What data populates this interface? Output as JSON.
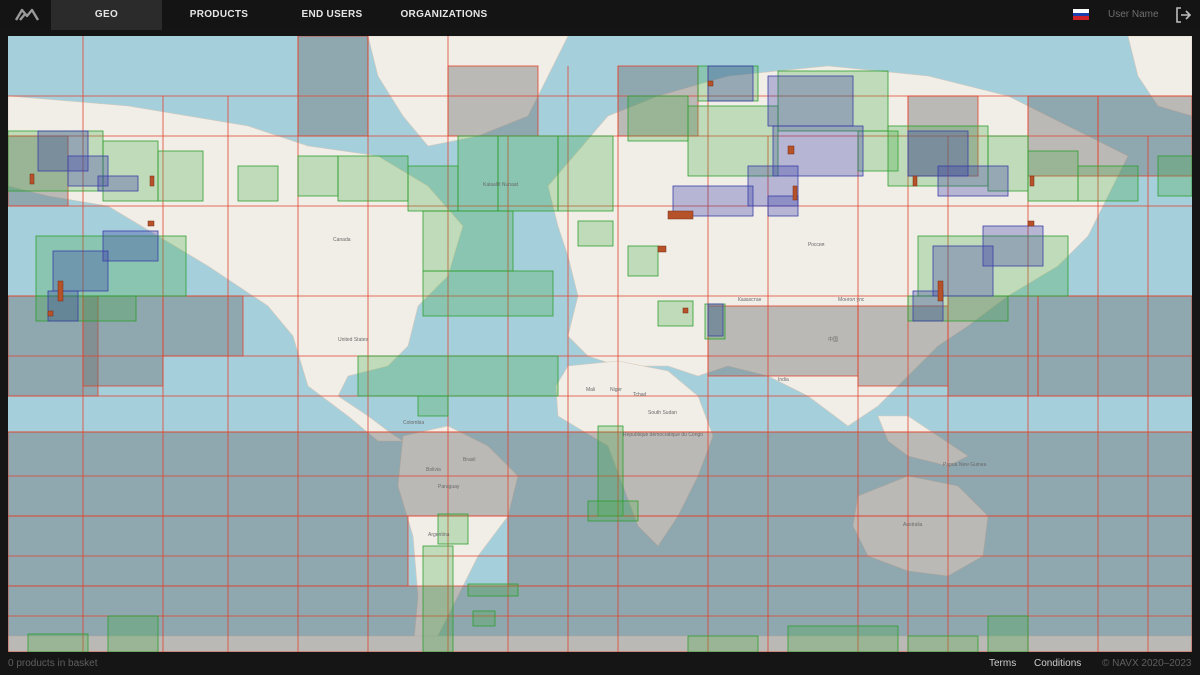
{
  "nav": {
    "tabs": [
      {
        "label": "GEO",
        "active": true
      },
      {
        "label": "PRODUCTS",
        "active": false
      },
      {
        "label": "END USERS",
        "active": false
      },
      {
        "label": "ORGANIZATIONS",
        "active": false
      }
    ]
  },
  "header": {
    "language_flag": "russia-flag-icon",
    "user_name": "User Name",
    "logout_icon": "logout-icon"
  },
  "map": {
    "labels": {
      "canada": "Canada",
      "united_states": "United States",
      "russia": "Россия",
      "kazakhstan": "Казахстан",
      "mongolia": "Монгол улс",
      "china": "中国",
      "india": "India",
      "mali": "Mali",
      "niger": "Niger",
      "chad": "Tchad",
      "drc": "République démocratique du Congo",
      "south_sudan": "South Sudan",
      "brasil": "Brasil",
      "bolivia": "Bolivia",
      "paraguay": "Paraguay",
      "argentina": "Argentina",
      "australia": "Australia",
      "papua": "Papua New Guinea",
      "colombia": "Colombia",
      "kalaallit": "Kalaallit Nunaat"
    },
    "colors": {
      "water": "#a6cfdc",
      "land": "#f2efe9",
      "red_grid": "#e2432c",
      "green_grid": "#3fae3f",
      "blue_grid": "#3b3fa8",
      "overlay": "#6f6f6f"
    }
  },
  "footer": {
    "basket": "0 products in basket",
    "terms": "Terms",
    "conditions": "Conditions",
    "copyright": "© NAVX 2020–2023"
  }
}
